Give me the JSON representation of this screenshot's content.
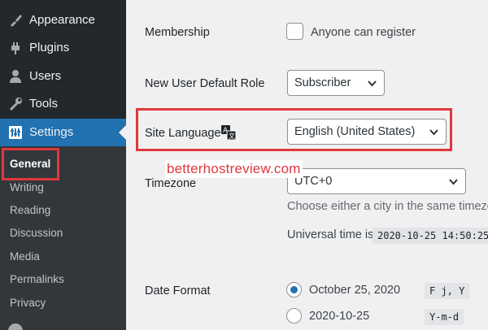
{
  "sidebar": {
    "items": [
      {
        "label": "Appearance",
        "icon": "paintbrush-icon"
      },
      {
        "label": "Plugins",
        "icon": "plug-icon"
      },
      {
        "label": "Users",
        "icon": "user-icon"
      },
      {
        "label": "Tools",
        "icon": "wrench-icon"
      },
      {
        "label": "Settings",
        "icon": "sliders-icon",
        "current": true
      }
    ],
    "submenu": [
      "General",
      "Writing",
      "Reading",
      "Discussion",
      "Media",
      "Permalinks",
      "Privacy"
    ],
    "current_submenu": "General"
  },
  "settings": {
    "membership": {
      "label": "Membership",
      "checkbox_label": "Anyone can register",
      "checked": false
    },
    "default_role": {
      "label": "New User Default Role",
      "value": "Subscriber"
    },
    "site_language": {
      "label": "Site Language",
      "value": "English (United States)"
    },
    "timezone": {
      "label": "Timezone",
      "value": "UTC+0",
      "description": "Choose either a city in the same timezo",
      "universal_label": "Universal time is",
      "universal_value": "2020-10-25 14:50:25"
    },
    "date_format": {
      "label": "Date Format",
      "options": [
        {
          "label": "October 25, 2020",
          "code": "F j, Y",
          "selected": true
        },
        {
          "label": "2020-10-25",
          "code": "Y-m-d",
          "selected": false
        }
      ]
    }
  },
  "watermark": "betterhostreview.com",
  "colors": {
    "accent": "#2271b1",
    "highlight": "#e0383d",
    "sidebar": "#23282d"
  }
}
